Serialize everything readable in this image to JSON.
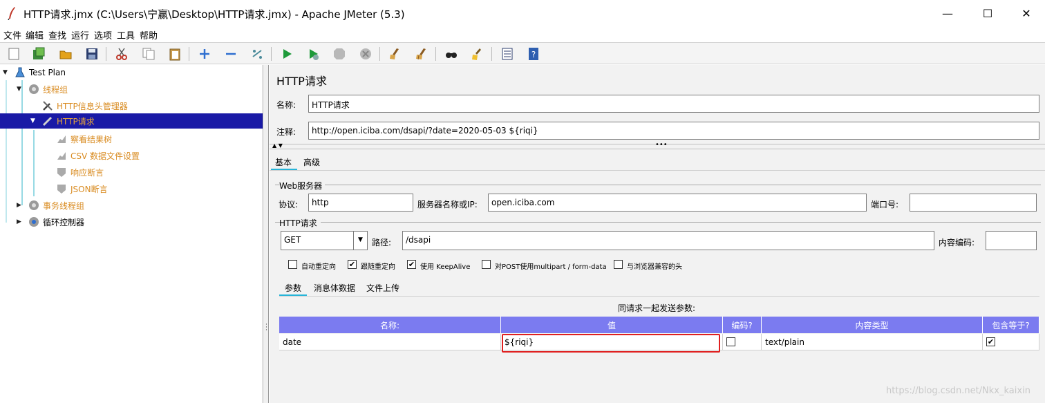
{
  "window": {
    "title": "HTTP请求.jmx (C:\\Users\\宁赢\\Desktop\\HTTP请求.jmx) - Apache JMeter (5.3)",
    "minimize": "—",
    "maximize": "☐",
    "close": "✕"
  },
  "menu": [
    "文件",
    "编辑",
    "查找",
    "运行",
    "选项",
    "工具",
    "帮助"
  ],
  "toolbar": {
    "icons": [
      "new-icon",
      "templates-icon",
      "open-icon",
      "save-icon",
      "cut-icon",
      "copy-icon",
      "paste-icon",
      "expand-icon",
      "collapse-icon",
      "toggle-icon",
      "start-icon",
      "start-no-pause-icon",
      "stop-icon",
      "shutdown-icon",
      "clear-icon",
      "clear-all-icon",
      "search-icon",
      "reset-search-icon",
      "function-helper-icon",
      "help-icon"
    ]
  },
  "tree": {
    "items": [
      {
        "label": "Test Plan",
        "toggle": "▼"
      },
      {
        "label": "线程组",
        "toggle": "▼"
      },
      {
        "label": "HTTP信息头管理器",
        "toggle": ""
      },
      {
        "label": "HTTP请求",
        "toggle": "▼"
      },
      {
        "label": "察看结果树",
        "toggle": ""
      },
      {
        "label": "CSV 数据文件设置",
        "toggle": ""
      },
      {
        "label": "响应断言",
        "toggle": ""
      },
      {
        "label": "JSON断言",
        "toggle": ""
      },
      {
        "label": "事务线程组",
        "toggle": "▶"
      },
      {
        "label": "循环控制器",
        "toggle": "▶"
      }
    ]
  },
  "panel": {
    "title": "HTTP请求",
    "name_label": "名称:",
    "name_value": "HTTP请求",
    "comment_label": "注释:",
    "comment_value": "http://open.iciba.com/dsapi/?date=2020-05-03  ${riqi}",
    "tabs": [
      "基本",
      "高级"
    ],
    "web_server_group": "Web服务器",
    "protocol_label": "协议:",
    "protocol_value": "http",
    "server_label": "服务器名称或IP:",
    "server_value": "open.iciba.com",
    "port_label": "端口号:",
    "port_value": "",
    "http_request_group": "HTTP请求",
    "method": "GET",
    "path_label": "路径:",
    "path_value": "/dsapi",
    "encoding_label": "内容编码:",
    "encoding_value": "",
    "options": [
      {
        "label": "自动重定向",
        "checked": false
      },
      {
        "label": "跟随重定向",
        "checked": true
      },
      {
        "label": "使用 KeepAlive",
        "checked": true
      },
      {
        "label": "对POST使用multipart / form-data",
        "checked": false
      },
      {
        "label": "与浏览器兼容的头",
        "checked": false
      }
    ],
    "sub_tabs": [
      "参数",
      "消息体数据",
      "文件上传"
    ],
    "params_caption": "同请求一起发送参数:",
    "table": {
      "headers": [
        "名称:",
        "值",
        "编码?",
        "内容类型",
        "包含等于?"
      ],
      "rows": [
        {
          "name": "date",
          "value": "${riqi}",
          "encode": false,
          "content_type": "text/plain",
          "include_equals": true
        }
      ]
    }
  },
  "watermark": "https://blog.csdn.net/Nkx_kaixin",
  "colors": {
    "selection": "#1a1aa6",
    "table_header": "#7b7bf0",
    "highlight_box": "#e02020",
    "tab_underline": "#27b4d8",
    "tree_label": "#d98b20"
  }
}
